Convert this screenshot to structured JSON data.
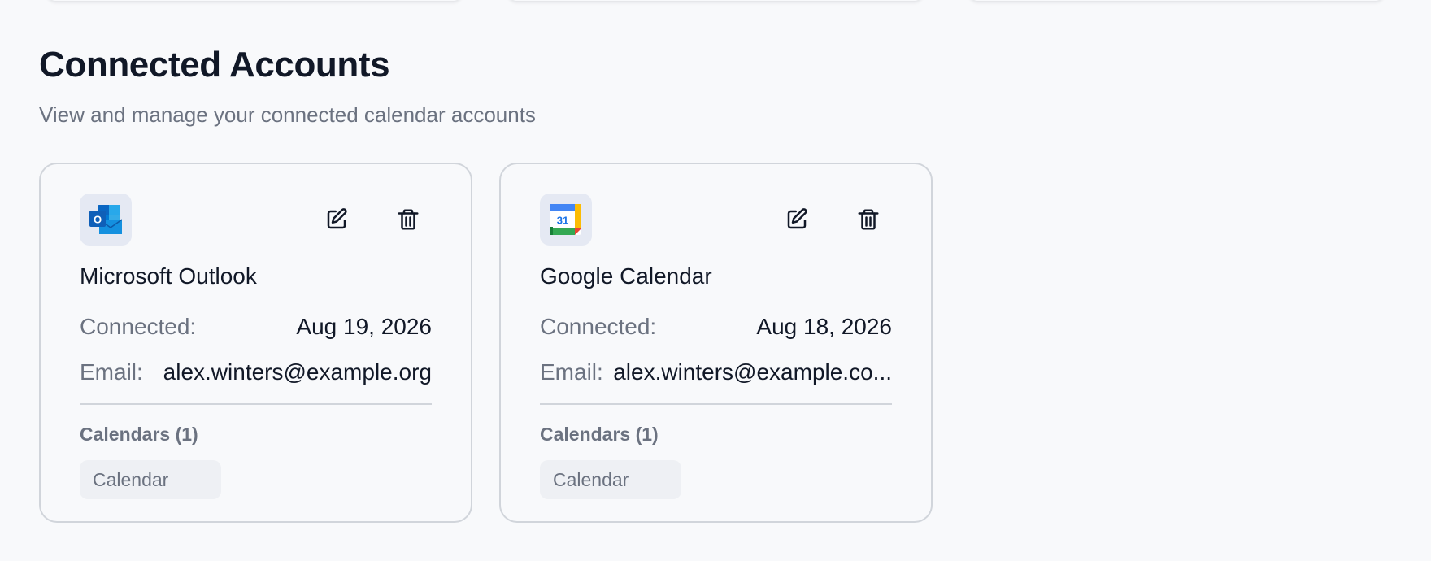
{
  "section": {
    "title": "Connected Accounts",
    "subtitle": "View and manage your connected calendar accounts"
  },
  "accounts": [
    {
      "name": "Microsoft Outlook",
      "logo_icon": "outlook-icon",
      "connected_label": "Connected:",
      "connected_date": "Aug 19, 2026",
      "email_label": "Email:",
      "email": "alex.winters@example.org",
      "calendars_heading": "Calendars (1)",
      "calendars": [
        "Calendar"
      ]
    },
    {
      "name": "Google Calendar",
      "logo_icon": "google-calendar-icon",
      "logo_text": "31",
      "connected_label": "Connected:",
      "connected_date": "Aug 18, 2026",
      "email_label": "Email:",
      "email": "alex.winters@example.co...",
      "calendars_heading": "Calendars (1)",
      "calendars": [
        "Calendar"
      ]
    }
  ],
  "icons": {
    "edit": "edit-icon",
    "delete": "trash-icon"
  },
  "colors": {
    "background": "#f8f9fb",
    "title": "#111827",
    "muted": "#6b7280",
    "border": "#d1d5db"
  }
}
